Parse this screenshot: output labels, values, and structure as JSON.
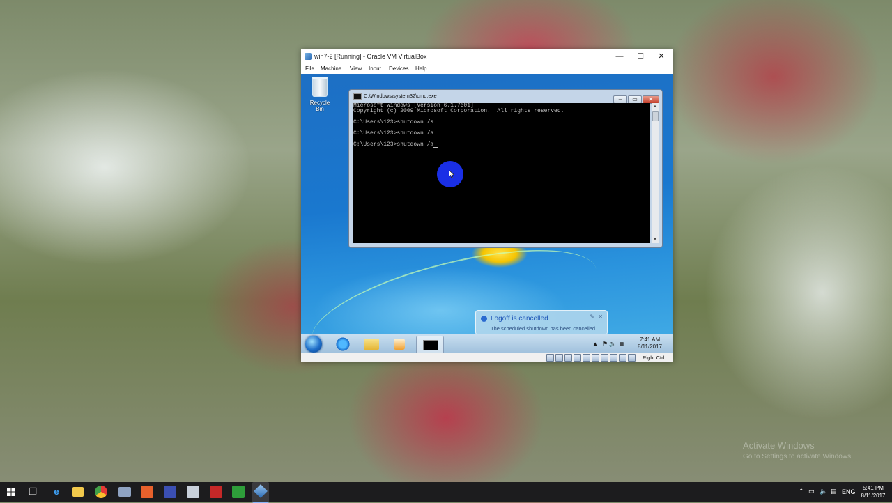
{
  "vbox": {
    "title": "win7-2 [Running] - Oracle VM VirtualBox",
    "menu": [
      "File",
      "Machine",
      "View",
      "Input",
      "Devices",
      "Help"
    ],
    "controls": {
      "minimize": "—",
      "maximize": "☐",
      "close": "✕"
    },
    "status_key": "Right Ctrl"
  },
  "guest": {
    "recycle_bin_label": "Recycle Bin",
    "cmd": {
      "title": "C:\\Windows\\system32\\cmd.exe",
      "lines": [
        "Microsoft Windows [Version 6.1.7601]",
        "Copyright (c) 2009 Microsoft Corporation.  All rights reserved.",
        "",
        "C:\\Users\\123>shutdown /s",
        "",
        "C:\\Users\\123>shutdown /a",
        "",
        "C:\\Users\\123>shutdown /a"
      ]
    },
    "toast": {
      "title": "Logoff is cancelled",
      "body": "The scheduled shutdown has been cancelled."
    },
    "clock": {
      "time": "7:41 AM",
      "date": "8/11/2017"
    }
  },
  "host": {
    "watermark": {
      "line1": "Activate Windows",
      "line2": "Go to Settings to activate Windows."
    },
    "tray_lang": "ENG",
    "clock": {
      "time": "5:41 PM",
      "date": "8/11/2017"
    }
  },
  "colors": {
    "guest_desktop": "#1a78cf",
    "console_bg": "#000000",
    "host_taskbar": "#1c1c1e",
    "toast_title": "#2259b8"
  }
}
